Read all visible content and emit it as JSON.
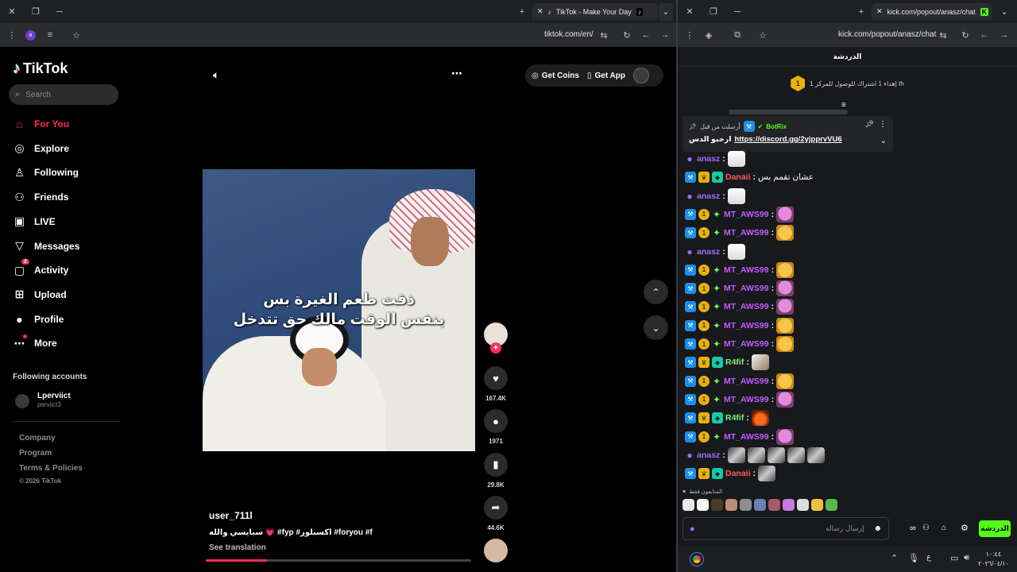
{
  "left_window": {
    "tab_title": "TikTok - Make Your Day",
    "url": "tiktok.com/en/",
    "profile_initial": "a"
  },
  "tiktok": {
    "brand": "TikTok",
    "search_placeholder": "Search",
    "nav": [
      {
        "label": "For You",
        "icon": "home-icon",
        "active": true
      },
      {
        "label": "Explore",
        "icon": "compass-icon"
      },
      {
        "label": "Following",
        "icon": "following-icon"
      },
      {
        "label": "Friends",
        "icon": "friends-icon"
      },
      {
        "label": "LIVE",
        "icon": "live-icon"
      },
      {
        "label": "Messages",
        "icon": "messages-icon"
      },
      {
        "label": "Activity",
        "icon": "activity-icon",
        "badge": "2"
      },
      {
        "label": "Upload",
        "icon": "upload-icon"
      },
      {
        "label": "Profile",
        "icon": "profile-icon"
      },
      {
        "label": "More",
        "icon": "more-icon",
        "dot": true
      }
    ],
    "following_title": "Following accounts",
    "following": [
      {
        "name": "Lperviict",
        "handle": "perviict3"
      }
    ],
    "footer": [
      "Company",
      "Program",
      "Terms & Policies",
      "© 2026 TikTok"
    ],
    "get_coins": "Get Coins",
    "get_app": "Get App",
    "video": {
      "caption_line1": "ذقت طعم الغيرة بس",
      "caption_line2": "بنفس الوقت مالك حق تتدخل",
      "author": "user_711l",
      "description": "سبايسي والله 💗 #fyp #اكسبلور #foryou #f",
      "see_translation": "See translation",
      "progress": 0.23
    },
    "actions": {
      "likes": "167.4K",
      "comments": "1971",
      "saves": "29.8K",
      "shares": "44.6K"
    }
  },
  "right_window": {
    "url": "kick.com/popout/anasz/chat",
    "tab_title": "kick.com/popout/anasz/chat"
  },
  "kick": {
    "header": "الدردشة",
    "goal_number": "1",
    "goal_text": "إهداء 1 اشتراك للوصول للمركز 1 th",
    "pinned_meta": "أرسلت من قبل",
    "pinned_user": "BotRix",
    "pinned_prefix": "ارحبو الدس",
    "pinned_link": "https://discord.gg/2yjpprvVU6",
    "messages": [
      {
        "user": "anasz",
        "color": "#a06bff",
        "badges": [
          "mic"
        ],
        "text": "",
        "emotes": [
          "goose"
        ]
      },
      {
        "user": "Danaii",
        "color": "#ff5a5a",
        "badges": [
          "mod",
          "crown",
          "vip"
        ],
        "text": "عشان تقمم بس",
        "emotes": []
      },
      {
        "user": "anasz",
        "color": "#a06bff",
        "badges": [
          "mic"
        ],
        "text": "",
        "emotes": [
          "goose"
        ]
      },
      {
        "user": "MT_AWS99",
        "color": "#c25cff",
        "badges": [
          "mod",
          "gold",
          "star"
        ],
        "text": "",
        "emotes": [
          "pink"
        ]
      },
      {
        "user": "MT_AWS99",
        "color": "#c25cff",
        "badges": [
          "mod",
          "gold",
          "star"
        ],
        "text": "",
        "emotes": [
          "cat"
        ]
      },
      {
        "user": "anasz",
        "color": "#a06bff",
        "badges": [
          "mic"
        ],
        "text": "",
        "emotes": [
          "goose"
        ]
      },
      {
        "user": "MT_AWS99",
        "color": "#c25cff",
        "badges": [
          "mod",
          "gold",
          "star"
        ],
        "text": "",
        "emotes": [
          "cat"
        ]
      },
      {
        "user": "MT_AWS99",
        "color": "#c25cff",
        "badges": [
          "mod",
          "gold",
          "star"
        ],
        "text": "",
        "emotes": [
          "pink"
        ]
      },
      {
        "user": "MT_AWS99",
        "color": "#c25cff",
        "badges": [
          "mod",
          "gold",
          "star"
        ],
        "text": "",
        "emotes": [
          "pink"
        ]
      },
      {
        "user": "MT_AWS99",
        "color": "#c25cff",
        "badges": [
          "mod",
          "gold",
          "star"
        ],
        "text": "",
        "emotes": [
          "cat"
        ]
      },
      {
        "user": "MT_AWS99",
        "color": "#c25cff",
        "badges": [
          "mod",
          "gold",
          "star"
        ],
        "text": "",
        "emotes": [
          "cat"
        ]
      },
      {
        "user": "R4fif",
        "color": "#7cf07c",
        "badges": [
          "mod",
          "crown",
          "vip"
        ],
        "text": "",
        "emotes": [
          "photo"
        ]
      },
      {
        "user": "MT_AWS99",
        "color": "#c25cff",
        "badges": [
          "mod",
          "gold",
          "star"
        ],
        "text": "",
        "emotes": [
          "cat"
        ]
      },
      {
        "user": "MT_AWS99",
        "color": "#c25cff",
        "badges": [
          "mod",
          "gold",
          "star"
        ],
        "text": "",
        "emotes": [
          "pink"
        ]
      },
      {
        "user": "R4fif",
        "color": "#7cf07c",
        "badges": [
          "mod",
          "crown",
          "vip"
        ],
        "text": "",
        "emotes": [
          "fire"
        ]
      },
      {
        "user": "MT_AWS99",
        "color": "#c25cff",
        "badges": [
          "mod",
          "gold",
          "star"
        ],
        "text": "",
        "emotes": [
          "pink"
        ]
      },
      {
        "user": "anasz",
        "color": "#a06bff",
        "badges": [
          "mic"
        ],
        "text": "",
        "emotes": [
          "gray",
          "gray",
          "gray",
          "gray",
          "gray"
        ]
      },
      {
        "user": "Danaii",
        "color": "#ff5a5a",
        "badges": [
          "mod",
          "crown",
          "vip"
        ],
        "text": "",
        "emotes": [
          "gray"
        ]
      }
    ],
    "viewers_label": "المتابعون فقط",
    "input_placeholder": "إرسال رسالة",
    "send_label": "الدردشة"
  },
  "taskbar": {
    "time": "١٠:٤٤",
    "date": "٢٠٢٦/٠٤/١٠"
  },
  "colors": {
    "tiktok_pink": "#fe2c55",
    "kick_green": "#53fc18"
  }
}
